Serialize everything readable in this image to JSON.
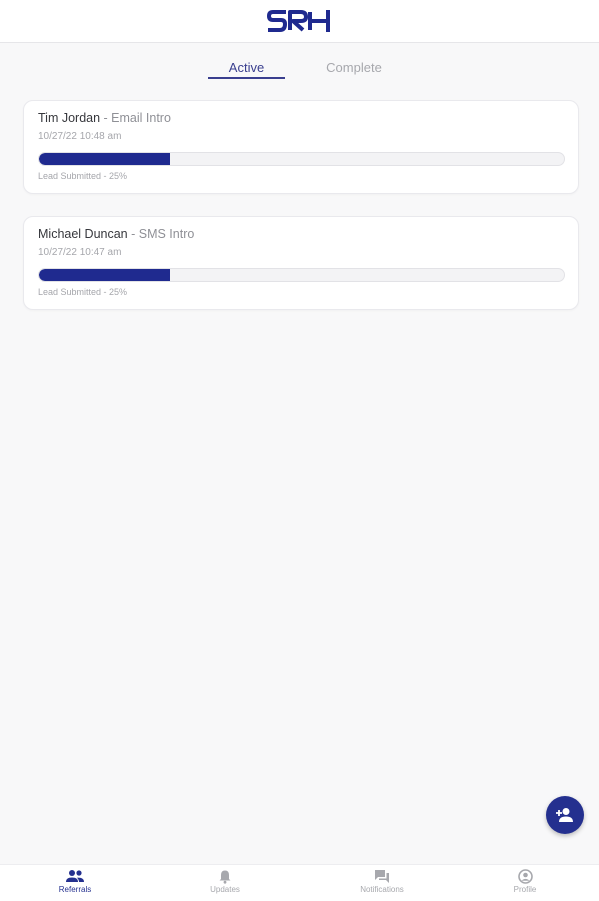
{
  "brand": {
    "logo_text": "SRH",
    "color": "#1f2a8f"
  },
  "tabs": [
    {
      "label": "Active",
      "selected": true
    },
    {
      "label": "Complete",
      "selected": false
    }
  ],
  "referrals": [
    {
      "name": "Tim Jordan",
      "separator": " - ",
      "type": "Email Intro",
      "date": "10/27/22 10:48 am",
      "progress": 0.25,
      "status": "Lead Submitted - 25%"
    },
    {
      "name": "Michael Duncan",
      "separator": " - ",
      "type": "SMS Intro",
      "date": "10/27/22 10:47 am",
      "progress": 0.25,
      "status": "Lead Submitted - 25%"
    }
  ],
  "fab": {
    "icon": "add-person-icon"
  },
  "bottom_nav": [
    {
      "label": "Referrals",
      "icon": "people-icon",
      "active": true
    },
    {
      "label": "Updates",
      "icon": "bell-icon",
      "active": false
    },
    {
      "label": "Notifications",
      "icon": "chat-icon",
      "active": false
    },
    {
      "label": "Profile",
      "icon": "account-circle-icon",
      "active": false
    }
  ],
  "colors": {
    "accent": "#1f2a8f",
    "tab_active": "#3a3f8f",
    "background": "#f8f8f9",
    "muted_text": "#a5a6ab"
  }
}
